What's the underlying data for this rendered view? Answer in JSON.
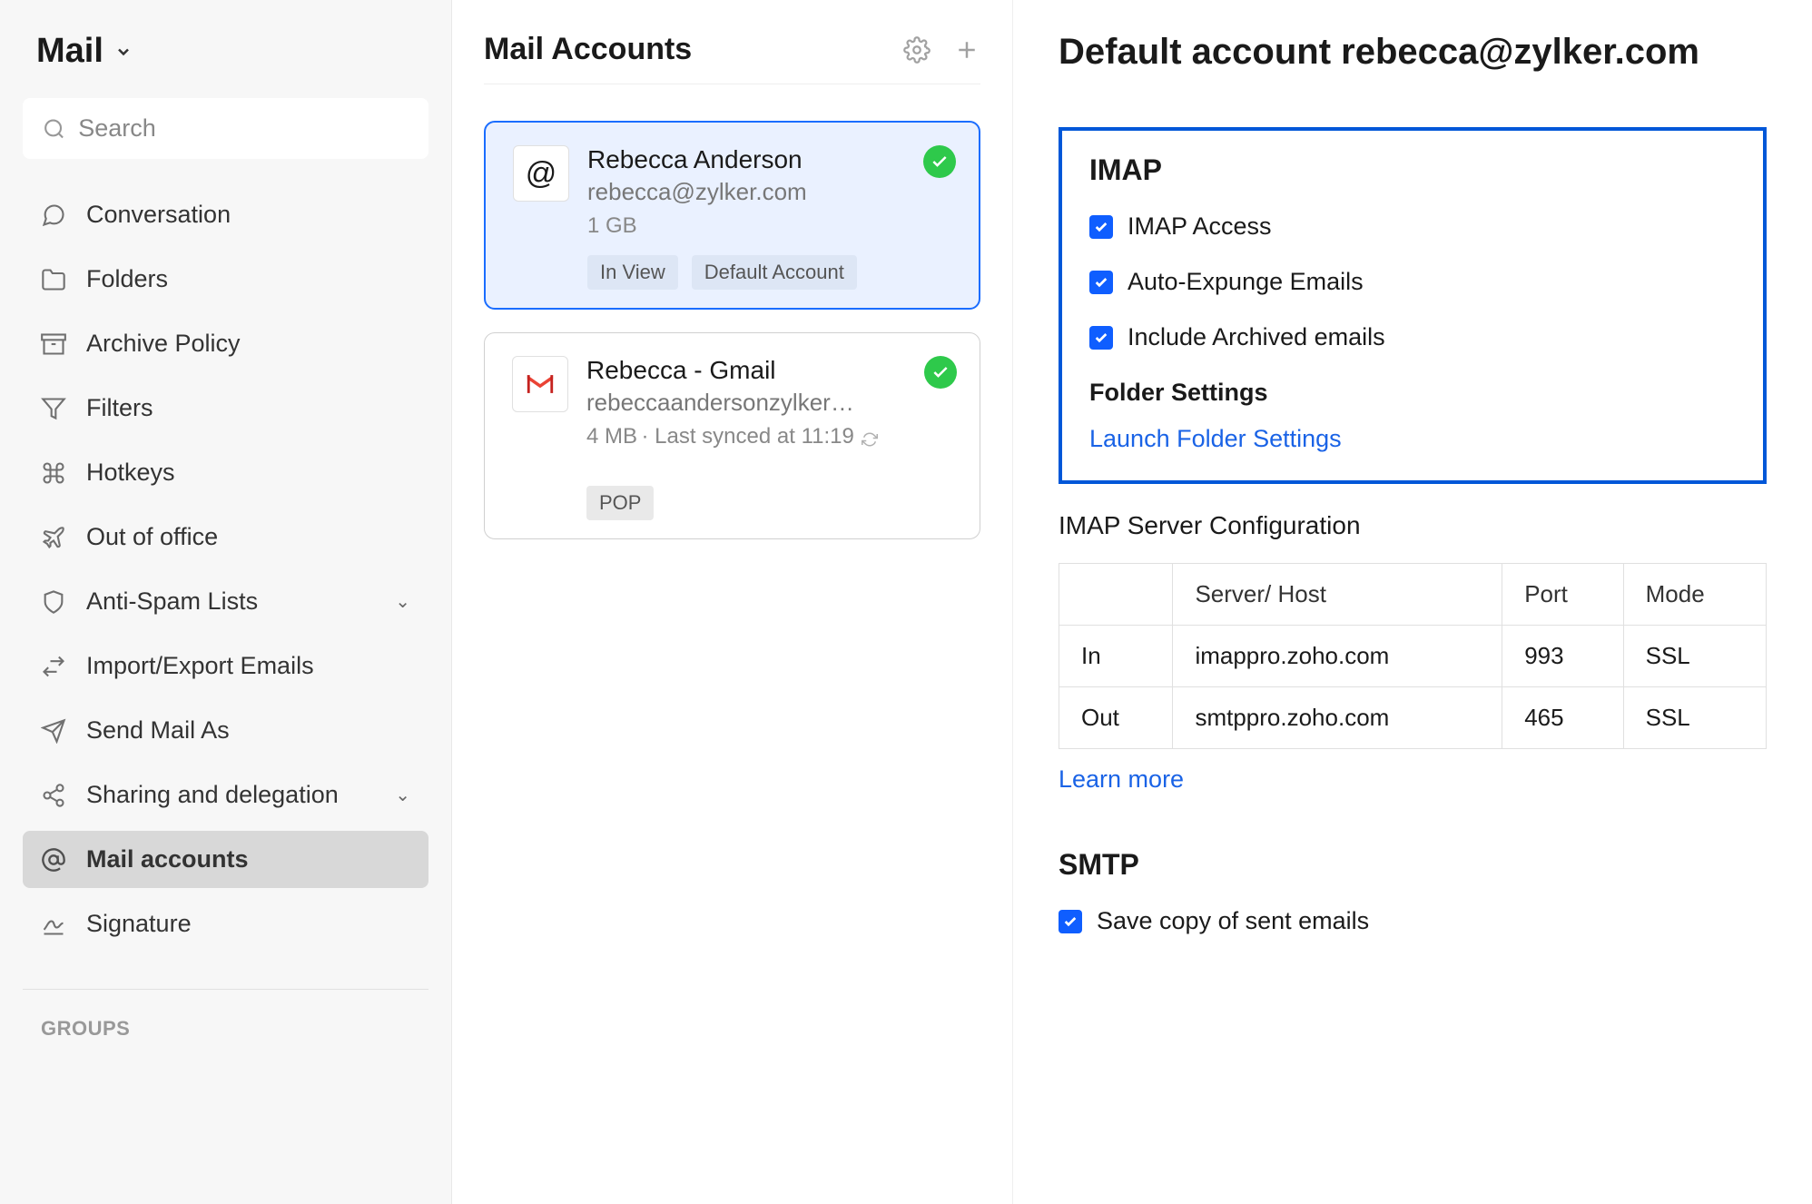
{
  "sidebar": {
    "title": "Mail",
    "search_placeholder": "Search",
    "items": [
      {
        "label": "Conversation"
      },
      {
        "label": "Folders"
      },
      {
        "label": "Archive Policy"
      },
      {
        "label": "Filters"
      },
      {
        "label": "Hotkeys"
      },
      {
        "label": "Out of office"
      },
      {
        "label": "Anti-Spam Lists",
        "expandable": true
      },
      {
        "label": "Import/Export Emails"
      },
      {
        "label": "Send Mail As"
      },
      {
        "label": "Sharing and delegation",
        "expandable": true
      },
      {
        "label": "Mail accounts",
        "active": true
      },
      {
        "label": "Signature"
      }
    ],
    "groups_header": "GROUPS"
  },
  "middle": {
    "title": "Mail Accounts",
    "accounts": [
      {
        "name": "Rebecca Anderson",
        "email": "rebecca@zylker.com",
        "size": "1 GB",
        "tags": [
          "In View",
          "Default Account"
        ],
        "selected": true,
        "icon": "at"
      },
      {
        "name": "Rebecca - Gmail",
        "email": "rebeccaandersonzylker@g…",
        "size": "4 MB",
        "sync": "Last synced at 11:19",
        "tags": [
          "POP"
        ],
        "selected": false,
        "icon": "gmail"
      }
    ]
  },
  "main": {
    "title": "Default account rebecca@zylker.com",
    "imap": {
      "heading": "IMAP",
      "checkboxes": [
        "IMAP Access",
        "Auto-Expunge Emails",
        "Include Archived emails"
      ],
      "folder_heading": "Folder Settings",
      "launch_link": "Launch Folder Settings"
    },
    "server_config": {
      "heading": "IMAP Server Configuration",
      "headers": [
        "",
        "Server/ Host",
        "Port",
        "Mode"
      ],
      "rows": [
        {
          "dir": "In",
          "host": "imappro.zoho.com",
          "port": "993",
          "mode": "SSL"
        },
        {
          "dir": "Out",
          "host": "smtppro.zoho.com",
          "port": "465",
          "mode": "SSL"
        }
      ],
      "learn_more": "Learn more"
    },
    "smtp": {
      "heading": "SMTP",
      "checkboxes": [
        "Save copy of sent emails"
      ]
    }
  }
}
